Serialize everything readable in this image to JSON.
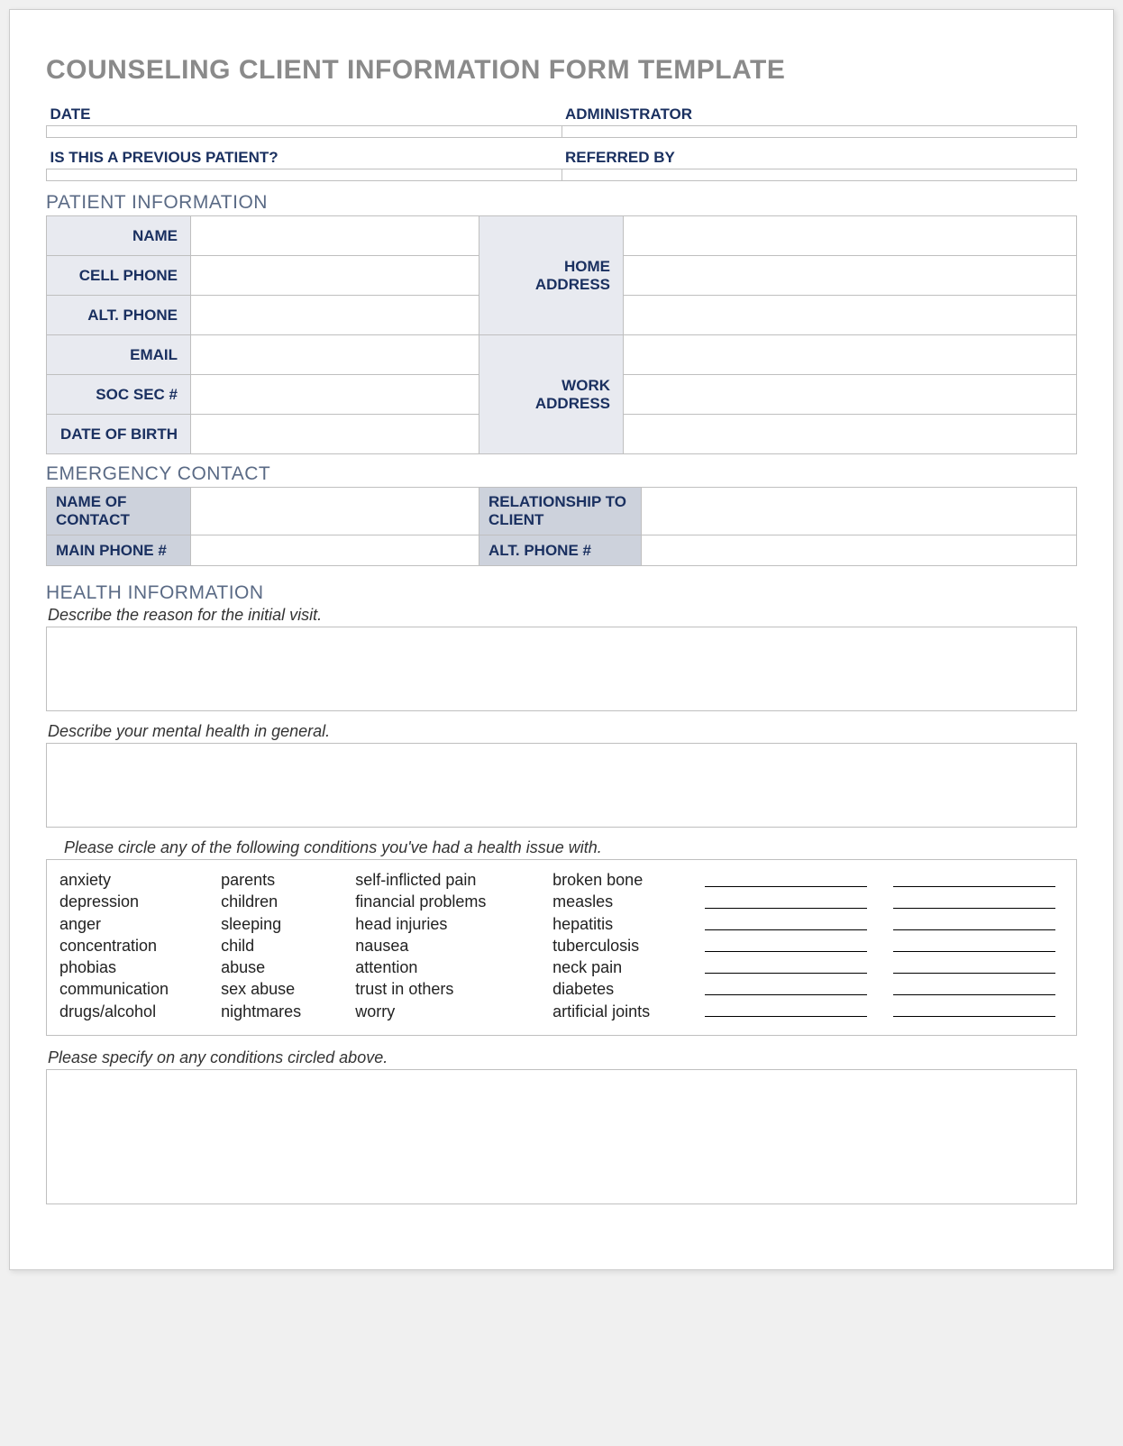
{
  "title": "COUNSELING CLIENT INFORMATION FORM TEMPLATE",
  "meta": {
    "date_label": "DATE",
    "administrator_label": "ADMINISTRATOR",
    "previous_patient_label": "IS THIS A PREVIOUS PATIENT?",
    "referred_by_label": "REFERRED BY"
  },
  "sections": {
    "patient_info": "PATIENT INFORMATION",
    "emergency": "EMERGENCY CONTACT",
    "health": "HEALTH INFORMATION"
  },
  "patient": {
    "name": "NAME",
    "cell_phone": "CELL PHONE",
    "alt_phone": "ALT. PHONE",
    "email": "EMAIL",
    "soc_sec": "SOC SEC #",
    "dob": "DATE OF BIRTH",
    "home_address": "HOME ADDRESS",
    "work_address": "WORK ADDRESS"
  },
  "emergency": {
    "name_of_contact": "NAME OF CONTACT",
    "relationship": "RELATIONSHIP TO CLIENT",
    "main_phone": "MAIN PHONE #",
    "alt_phone": "ALT. PHONE #"
  },
  "health": {
    "reason_instruction": "Describe the reason for the initial visit.",
    "general_instruction": "Describe your mental health in general.",
    "circle_instruction": "Please circle any of the following conditions you've had a health issue with.",
    "specify_instruction": "Please specify on any conditions circled above."
  },
  "conditions": {
    "col1": [
      "anxiety",
      "depression",
      "anger",
      "concentration",
      "phobias",
      "communication",
      "drugs/alcohol"
    ],
    "col2": [
      "parents",
      "children",
      "sleeping",
      "child",
      "abuse",
      "sex abuse",
      "nightmares"
    ],
    "col3": [
      "self-inflicted pain",
      "financial problems",
      "head injuries",
      "nausea",
      "attention",
      "trust in others",
      "worry"
    ],
    "col4": [
      "broken bone",
      "measles",
      "hepatitis",
      "tuberculosis",
      "neck pain",
      "diabetes",
      "artificial joints"
    ]
  }
}
